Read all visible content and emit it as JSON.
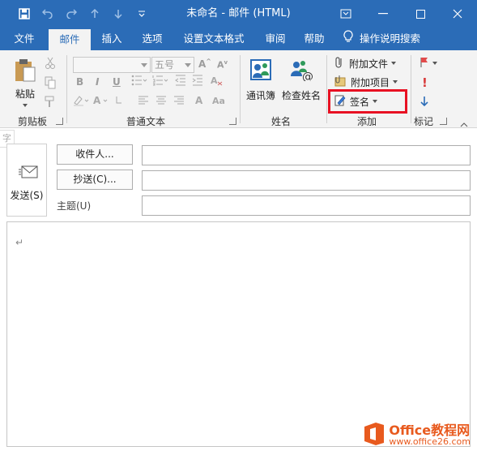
{
  "window": {
    "title": "未命名 - 邮件 (HTML)"
  },
  "tabs": [
    {
      "label": "文件"
    },
    {
      "label": "邮件"
    },
    {
      "label": "插入"
    },
    {
      "label": "选项"
    },
    {
      "label": "设置文本格式"
    },
    {
      "label": "审阅"
    },
    {
      "label": "帮助"
    }
  ],
  "tell_me": {
    "label": "操作说明搜索"
  },
  "ribbon": {
    "clipboard": {
      "paste_label": "粘贴",
      "group_label": "剪贴板"
    },
    "basic_text": {
      "font_size_placeholder": "五号",
      "group_label": "普通文本"
    },
    "names": {
      "address_book_label": "通讯簿",
      "check_names_label": "检查姓名",
      "group_label": "姓名"
    },
    "include": {
      "attach_file_label": "附加文件",
      "attach_item_label": "附加项目",
      "signature_label": "签名",
      "group_label": "添加"
    },
    "tags": {
      "group_label": "标记"
    }
  },
  "form": {
    "send_label": "发送(S)",
    "to_button": "收件人...",
    "cc_button": "抄送(C)...",
    "subject_label": "主题(U)",
    "to_value": "",
    "cc_value": "",
    "subject_value": ""
  },
  "side_hint": "字",
  "body": {
    "paragraph_mark": "↵"
  },
  "watermark": {
    "brand": "Office教程网",
    "url": "www.office26.com"
  },
  "colors": {
    "title_bar": "#2b6cb7",
    "highlight": "#e81123",
    "ribbon_bg": "#f3f3f3"
  }
}
